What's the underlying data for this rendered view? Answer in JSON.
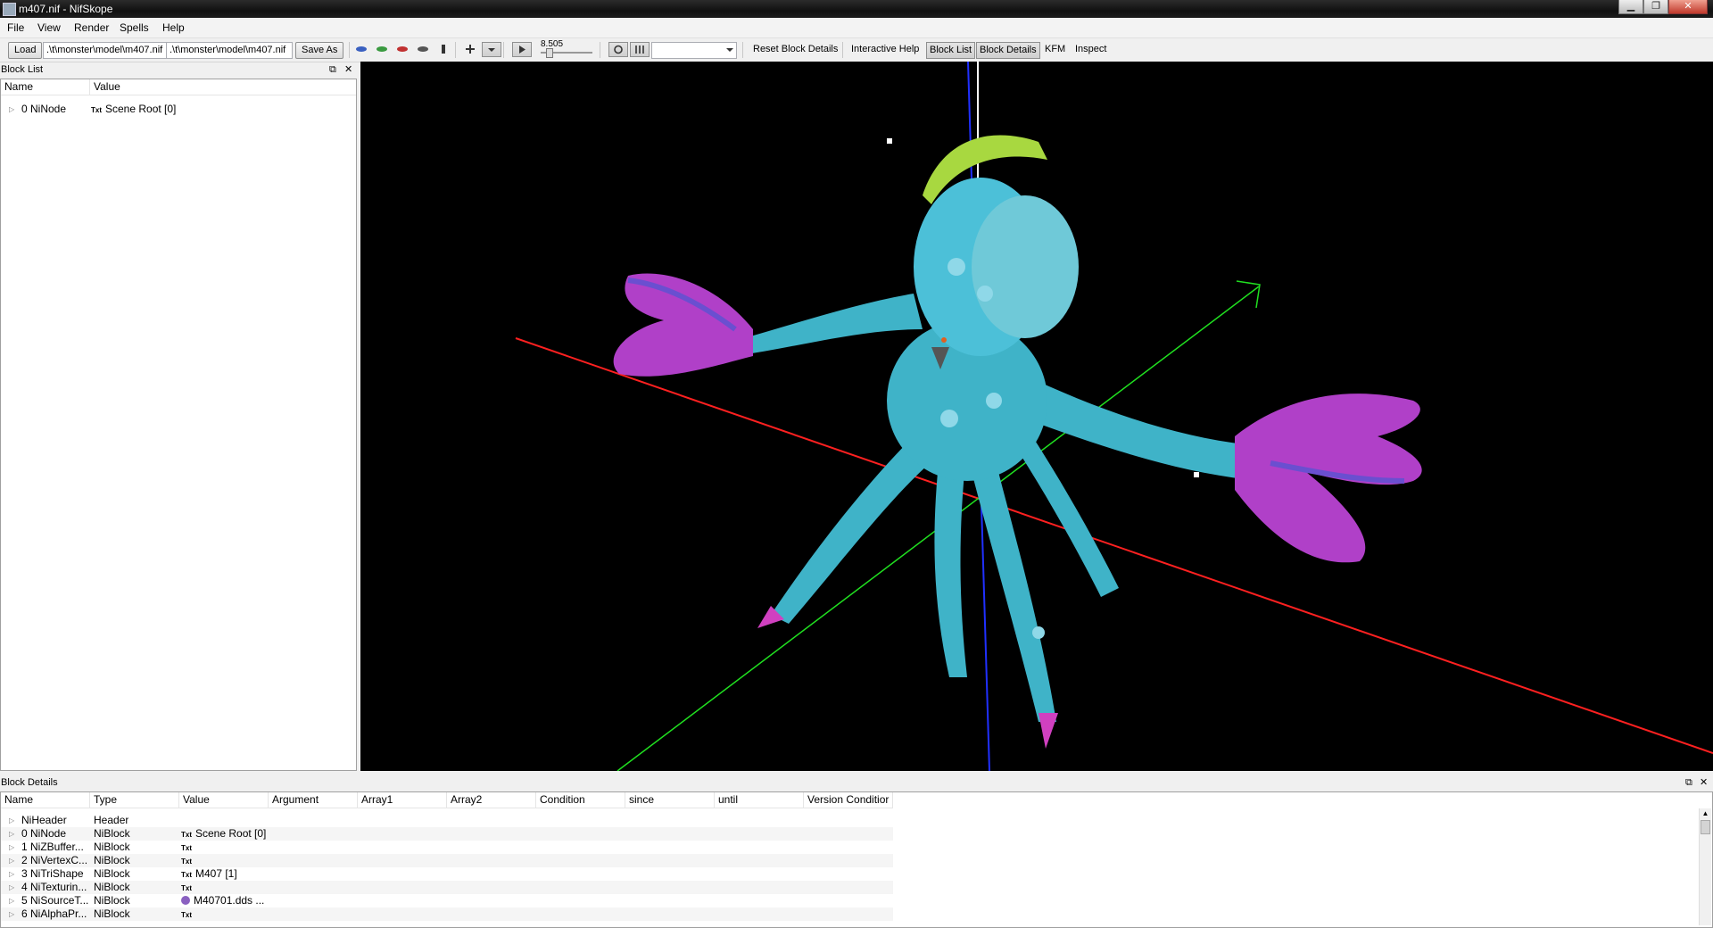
{
  "window": {
    "title": "m407.nif - NifSkope"
  },
  "menu": [
    "File",
    "View",
    "Render",
    "Spells",
    "Help"
  ],
  "toolbar": {
    "load_label": "Load",
    "path_load": ".\\t\\monster\\model\\m407.nif",
    "path_save": ".\\t\\monster\\model\\m407.nif",
    "save_as_label": "Save As",
    "speed_value": "8.505",
    "reset_label": "Reset Block Details",
    "help_label": "Interactive Help",
    "block_list_label": "Block List",
    "block_details_label": "Block Details",
    "kfm_label": "KFM",
    "inspect_label": "Inspect"
  },
  "block_list": {
    "title": "Block List",
    "columns": [
      "Name",
      "Value"
    ],
    "rows": [
      {
        "name": "0 NiNode",
        "icon": "Txt",
        "value": "Scene Root [0]"
      }
    ]
  },
  "block_details": {
    "title": "Block Details",
    "columns": [
      "Name",
      "Type",
      "Value",
      "Argument",
      "Array1",
      "Array2",
      "Condition",
      "since",
      "until",
      "Version Conditior"
    ],
    "rows": [
      {
        "name": "NiHeader",
        "type": "Header",
        "icon": "",
        "value": ""
      },
      {
        "name": "0 NiNode",
        "type": "NiBlock",
        "icon": "Txt",
        "value": "Scene Root [0]"
      },
      {
        "name": "1 NiZBuffer...",
        "type": "NiBlock",
        "icon": "Txt",
        "value": ""
      },
      {
        "name": "2 NiVertexC...",
        "type": "NiBlock",
        "icon": "Txt",
        "value": ""
      },
      {
        "name": "3 NiTriShape",
        "type": "NiBlock",
        "icon": "Txt",
        "value": "M407 [1]"
      },
      {
        "name": "4 NiTexturin...",
        "type": "NiBlock",
        "icon": "Txt",
        "value": ""
      },
      {
        "name": "5 NiSourceT...",
        "type": "NiBlock",
        "icon": "texture-icon",
        "value": "M40701.dds ..."
      },
      {
        "name": "6 NiAlphaPr...",
        "type": "NiBlock",
        "icon": "Txt",
        "value": ""
      }
    ]
  },
  "colors": {
    "axis_x": "#ff2020",
    "axis_y": "#20e020",
    "axis_z": "#2030ff",
    "viewport_bg": "#000000",
    "model_body": "#3fb3c8",
    "model_fins": "#b040c8"
  }
}
